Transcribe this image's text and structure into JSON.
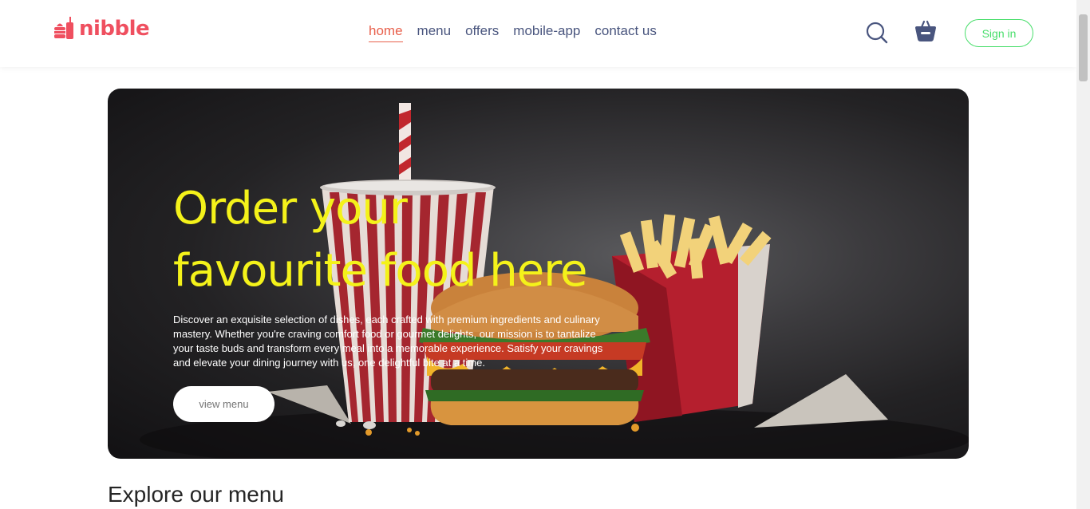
{
  "logo": {
    "text": "nibble"
  },
  "nav": {
    "items": [
      {
        "label": "home",
        "active": true
      },
      {
        "label": "menu",
        "active": false
      },
      {
        "label": "offers",
        "active": false
      },
      {
        "label": "mobile-app",
        "active": false
      },
      {
        "label": "contact us",
        "active": false
      }
    ],
    "search_icon": "search-icon",
    "basket_icon": "basket-icon",
    "signin_label": "Sign in"
  },
  "hero": {
    "title_line1": "Order your",
    "title_line2": "favourite food here",
    "description": "Discover an exquisite selection of dishes, each crafted with premium ingredients and culinary mastery. Whether you're craving comfort food or gourmet delights, our mission is to tantalize your taste buds and transform every meal into a memorable experience. Satisfy your cravings and elevate your dining journey with us, one delightful bite at a time.",
    "button_label": "view menu"
  },
  "explore": {
    "title": "Explore our menu"
  },
  "colors": {
    "accent": "#e8604c",
    "brand": "#ef4f5f",
    "title_yellow": "#f4f21a",
    "signin_green": "#47de6a",
    "nav_text": "#49557e"
  }
}
